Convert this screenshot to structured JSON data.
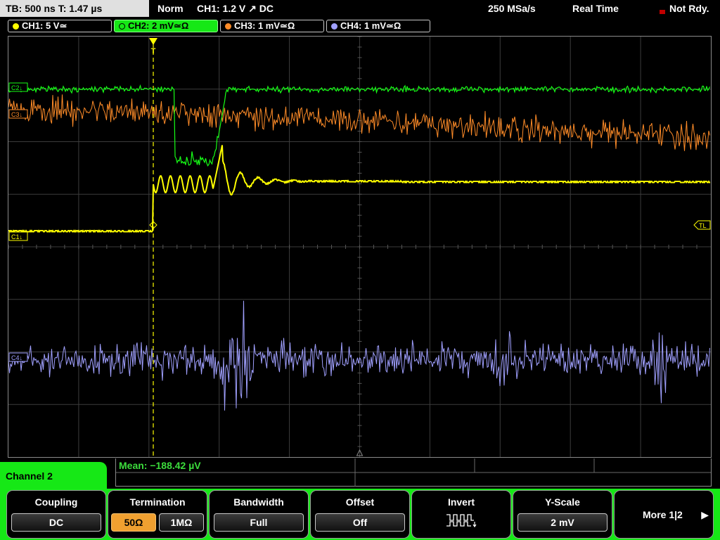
{
  "status_bar": {
    "timebase": "TB: 500 ns   T: 1.47 µs",
    "mode": "Norm",
    "trigger": "CH1: 1.2 V ↗ DC",
    "sample_rate": "250 MSa/s",
    "acquisition": "Real Time",
    "state": "Not Rdy."
  },
  "channel_tabs": [
    {
      "label": "CH1: 5 V≃",
      "color": "#ffff00"
    },
    {
      "label": "CH2: 2 mV≃Ω",
      "color": "#00ff00"
    },
    {
      "label": "CH3: 1 mV≃Ω",
      "color": "#ff8c28"
    },
    {
      "label": "CH4: 1 mV≃Ω",
      "color": "#a0a0ff"
    }
  ],
  "markers": {
    "ch1": "C1↓",
    "ch2": "C2↓",
    "ch3": "C3↓",
    "ch4": "C4↓",
    "trigger_level": "TL",
    "trigger_pos": "T"
  },
  "measurement": {
    "label": "Mean: −188.42 µV"
  },
  "menu": {
    "channel": "Channel 2",
    "coupling": {
      "title": "Coupling",
      "value": "DC"
    },
    "termination": {
      "title": "Termination",
      "option_a": "50Ω",
      "option_b": "1MΩ",
      "selected": "50Ω"
    },
    "bandwidth": {
      "title": "Bandwidth",
      "value": "Full"
    },
    "offset": {
      "title": "Offset",
      "value": "Off"
    },
    "invert": {
      "title": "Invert"
    },
    "yscale": {
      "title": "Y-Scale",
      "value": "2 mV"
    },
    "more": {
      "label": "More 1|2"
    }
  },
  "colors": {
    "ch1": "#ffff00",
    "ch2": "#00ff00",
    "ch3": "#ff8c28",
    "ch4": "#a0a0ff",
    "menu_accent": "#16e816",
    "selected_option": "#f0a030"
  }
}
